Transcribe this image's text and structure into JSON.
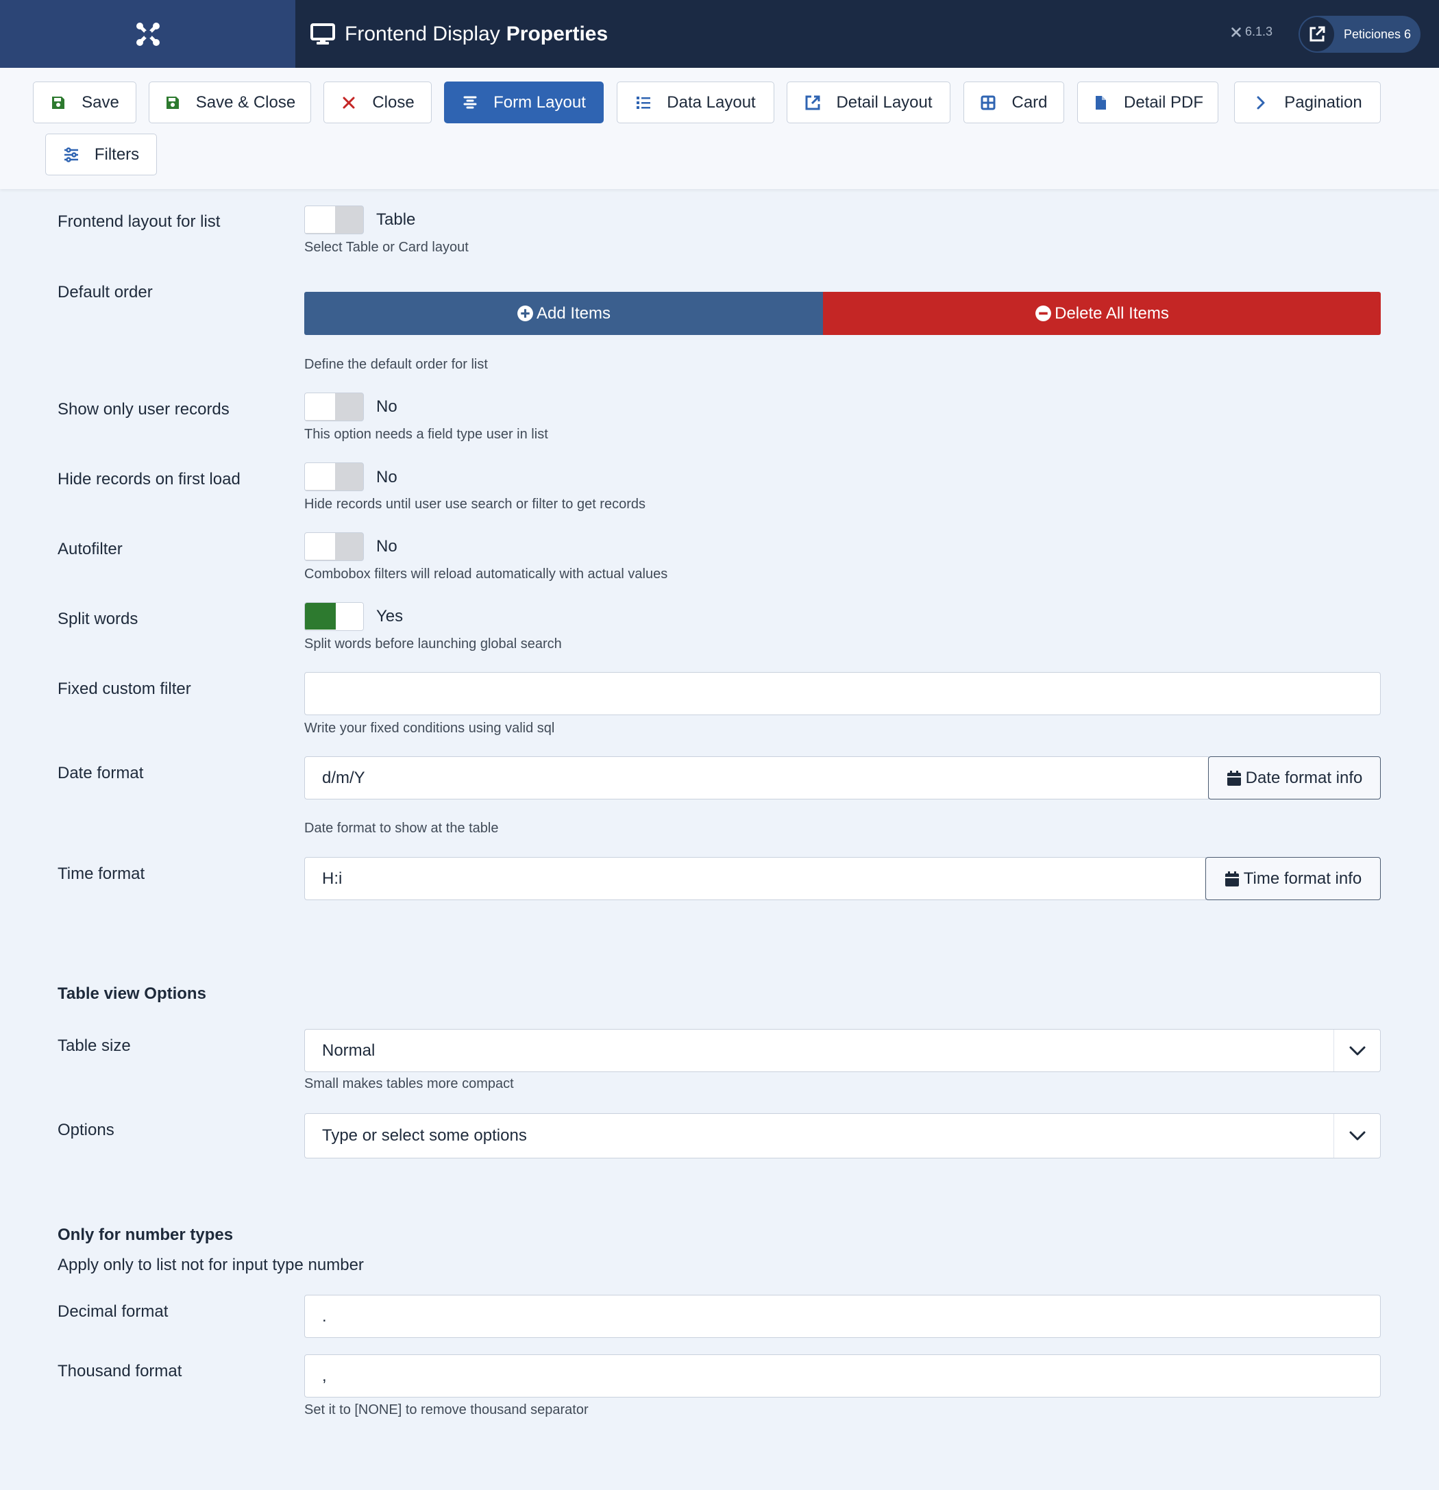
{
  "header": {
    "title_regular": "Frontend Display",
    "title_bold": "Properties",
    "version": "6.1.3",
    "site_button_label": "Peticiones 6",
    "icons": {
      "brand": "joomla-icon",
      "title": "monitor-icon",
      "site": "external-link-icon"
    }
  },
  "toolbar": {
    "buttons": [
      {
        "label": "Save",
        "icon": "save-icon"
      },
      {
        "label": "Save & Close",
        "icon": "save-icon"
      },
      {
        "label": "Close",
        "icon": "close-icon"
      },
      {
        "label": "Form Layout",
        "icon": "align-center-icon",
        "active": true
      },
      {
        "label": "Data Layout",
        "icon": "list-icon"
      },
      {
        "label": "Detail Layout",
        "icon": "external-link-icon"
      },
      {
        "label": "Card",
        "icon": "grid-icon"
      },
      {
        "label": "Detail PDF",
        "icon": "file-icon"
      },
      {
        "label": "Pagination",
        "icon": "chevron-right-icon"
      },
      {
        "label": "Filters",
        "icon": "sliders-icon"
      }
    ]
  },
  "form": {
    "frontend_layout": {
      "label": "Frontend layout for list",
      "value": "Table",
      "hint": "Select Table or Card layout"
    },
    "default_order": {
      "label": "Default order",
      "add_label": "Add Items",
      "delete_label": "Delete All Items",
      "hint": "Define the default order for list"
    },
    "show_only_user": {
      "label": "Show only user records",
      "value": "No",
      "hint": "This option needs a field type user in list"
    },
    "hide_first_load": {
      "label": "Hide records on first load",
      "value": "No",
      "hint": "Hide records until user use search or filter to get records"
    },
    "autofilter": {
      "label": "Autofilter",
      "value": "No",
      "hint": "Combobox filters will reload automatically with actual values"
    },
    "split_words": {
      "label": "Split words",
      "value": "Yes",
      "hint": "Split words before launching global search"
    },
    "fixed_filter": {
      "label": "Fixed custom filter",
      "value": "",
      "hint": "Write your fixed conditions using valid sql"
    },
    "date_format": {
      "label": "Date format",
      "value": "d/m/Y",
      "button": "Date format info",
      "hint": "Date format to show at the table"
    },
    "time_format": {
      "label": "Time format",
      "value": "H:i",
      "button": "Time format info"
    },
    "table_view": {
      "title": "Table view Options",
      "table_size": {
        "label": "Table size",
        "value": "Normal",
        "hint": "Small makes tables more compact"
      },
      "options": {
        "label": "Options",
        "placeholder": "Type or select some options"
      }
    },
    "number_types": {
      "title": "Only for number types",
      "subtitle": "Apply only to list not for input type number",
      "decimal": {
        "label": "Decimal format",
        "value": "."
      },
      "thousand": {
        "label": "Thousand format",
        "value": ",",
        "hint": "Set it to [NONE] to remove thousand separator"
      }
    }
  },
  "colors": {
    "header_bg": "#1b2a44",
    "brand_bg": "#2c4576",
    "active_button": "#2f64b2",
    "add_button": "#3b5f8e",
    "delete_button": "#c42625",
    "switch_on": "#2d7a2f",
    "save_icon": "#2d7a2f",
    "close_icon": "#c42625"
  }
}
